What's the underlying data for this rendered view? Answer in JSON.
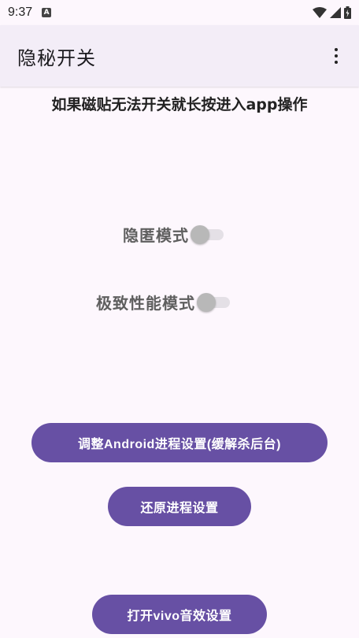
{
  "status_bar": {
    "time": "9:37",
    "badge_letter": "A",
    "icons": [
      "wifi-icon",
      "signal-icon",
      "battery-icon"
    ]
  },
  "app_bar": {
    "title": "隐秘开关",
    "menu_icon": "more-vert-icon"
  },
  "hint": "如果磁贴无法开关就长按进入app操作",
  "switches": [
    {
      "label": "隐匿模式",
      "checked": false
    },
    {
      "label": "极致性能模式",
      "checked": false
    }
  ],
  "buttons": {
    "adjust_process": "调整Android进程设置(缓解杀后台)",
    "restore_process": "还原进程设置",
    "vivo_audio": "打开vivo音效设置"
  },
  "colors": {
    "primary": "#6750a4",
    "background": "#fdf7fd",
    "app_bar": "#f3edf7"
  }
}
